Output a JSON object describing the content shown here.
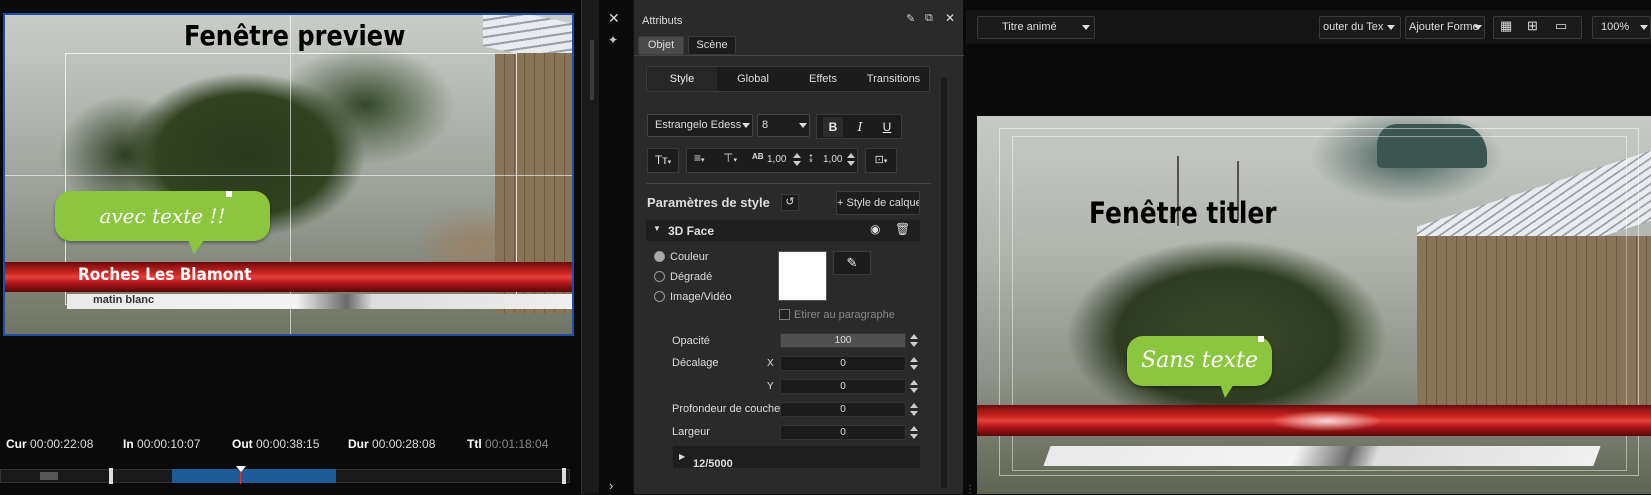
{
  "preview": {
    "title": "Fenêtre preview",
    "bubble_text": "avec texte !!",
    "lower_third_title": "Roches Les Blamont",
    "lower_third_subtitle": "matin blanc"
  },
  "timecodes": {
    "cur_label": "Cur",
    "cur_value": "00:00:22:08",
    "in_label": "In",
    "in_value": "00:00:10:07",
    "out_label": "Out",
    "out_value": "00:00:38:15",
    "dur_label": "Dur",
    "dur_value": "00:00:28:08",
    "ttl_label": "Ttl",
    "ttl_value": "00:01:18:04"
  },
  "panel": {
    "title": "Attributs",
    "tabs": [
      "Objet",
      "Scène"
    ],
    "subtabs": [
      "Style",
      "Global",
      "Effets",
      "Transitions"
    ],
    "font_name": "Estrangelo Edess",
    "font_size": "8",
    "bold": "B",
    "italic": "I",
    "underline": "U",
    "spacing_value": "1,00",
    "leading_value": "1,00",
    "style_params_label": "Paramètres de style",
    "style_layer_button": "+ Style de calque",
    "section_name": "3D Face",
    "fill_options": [
      "Couleur",
      "Dégradé",
      "Image/Vidéo"
    ],
    "fill_selected": "Couleur",
    "fill_color": "#ffffff",
    "stretch_label": "Etirer au paragraphe",
    "opacity_label": "Opacité",
    "opacity_value": "100",
    "offset_label": "Décalage",
    "x_label": "X",
    "x_value": "0",
    "y_label": "Y",
    "y_value": "0",
    "depth_label": "Profondeur de couche",
    "depth_value": "0",
    "width_label": "Largeur",
    "width_value": "0",
    "counter": "12/5000"
  },
  "titler": {
    "type_select": "Titre animé",
    "add_text": "outer du Tex",
    "add_shape": "Ajouter Forme",
    "zoom": "100%",
    "title": "Fenêtre titler",
    "bubble_text": "Sans texte"
  },
  "colors": {
    "accent_blue": "#1e4fa8",
    "bubble_green": "#8cc63f",
    "bar_red": "#c9231f",
    "timeline_blue": "#1f5a99"
  }
}
